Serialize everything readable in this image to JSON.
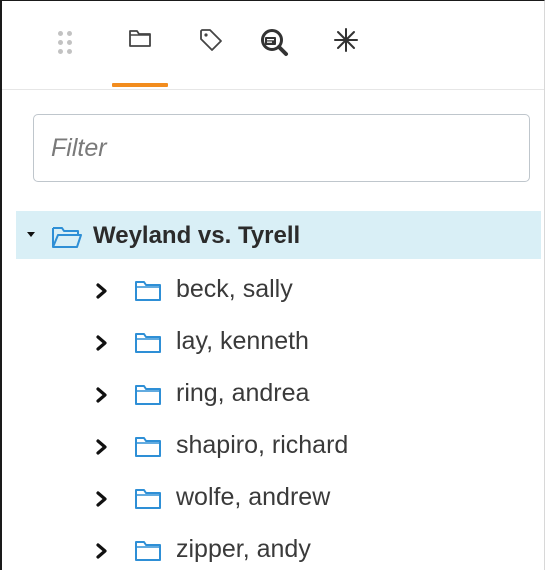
{
  "toolbar": {
    "tabs": [
      {
        "icon": "folder-icon",
        "active": true
      },
      {
        "icon": "tag-icon",
        "active": false
      },
      {
        "icon": "search-document-icon",
        "active": false
      },
      {
        "icon": "asterisk-icon",
        "active": false
      }
    ],
    "accent_color": "#f28c1e"
  },
  "filter": {
    "placeholder": "Filter",
    "value": ""
  },
  "tree": {
    "root": {
      "label": "Weyland vs. Tyrell",
      "expanded": true,
      "icon": "open-folder-icon",
      "highlight_color": "#d9eff6"
    },
    "children": [
      {
        "label": "beck, sally",
        "expanded": false,
        "icon": "folder-icon"
      },
      {
        "label": "lay, kenneth",
        "expanded": false,
        "icon": "folder-icon"
      },
      {
        "label": "ring, andrea",
        "expanded": false,
        "icon": "folder-icon"
      },
      {
        "label": "shapiro, richard",
        "expanded": false,
        "icon": "folder-icon"
      },
      {
        "label": "wolfe, andrew",
        "expanded": false,
        "icon": "folder-icon"
      },
      {
        "label": "zipper, andy",
        "expanded": false,
        "icon": "folder-icon"
      }
    ],
    "folder_color": "#2e8fd6"
  }
}
